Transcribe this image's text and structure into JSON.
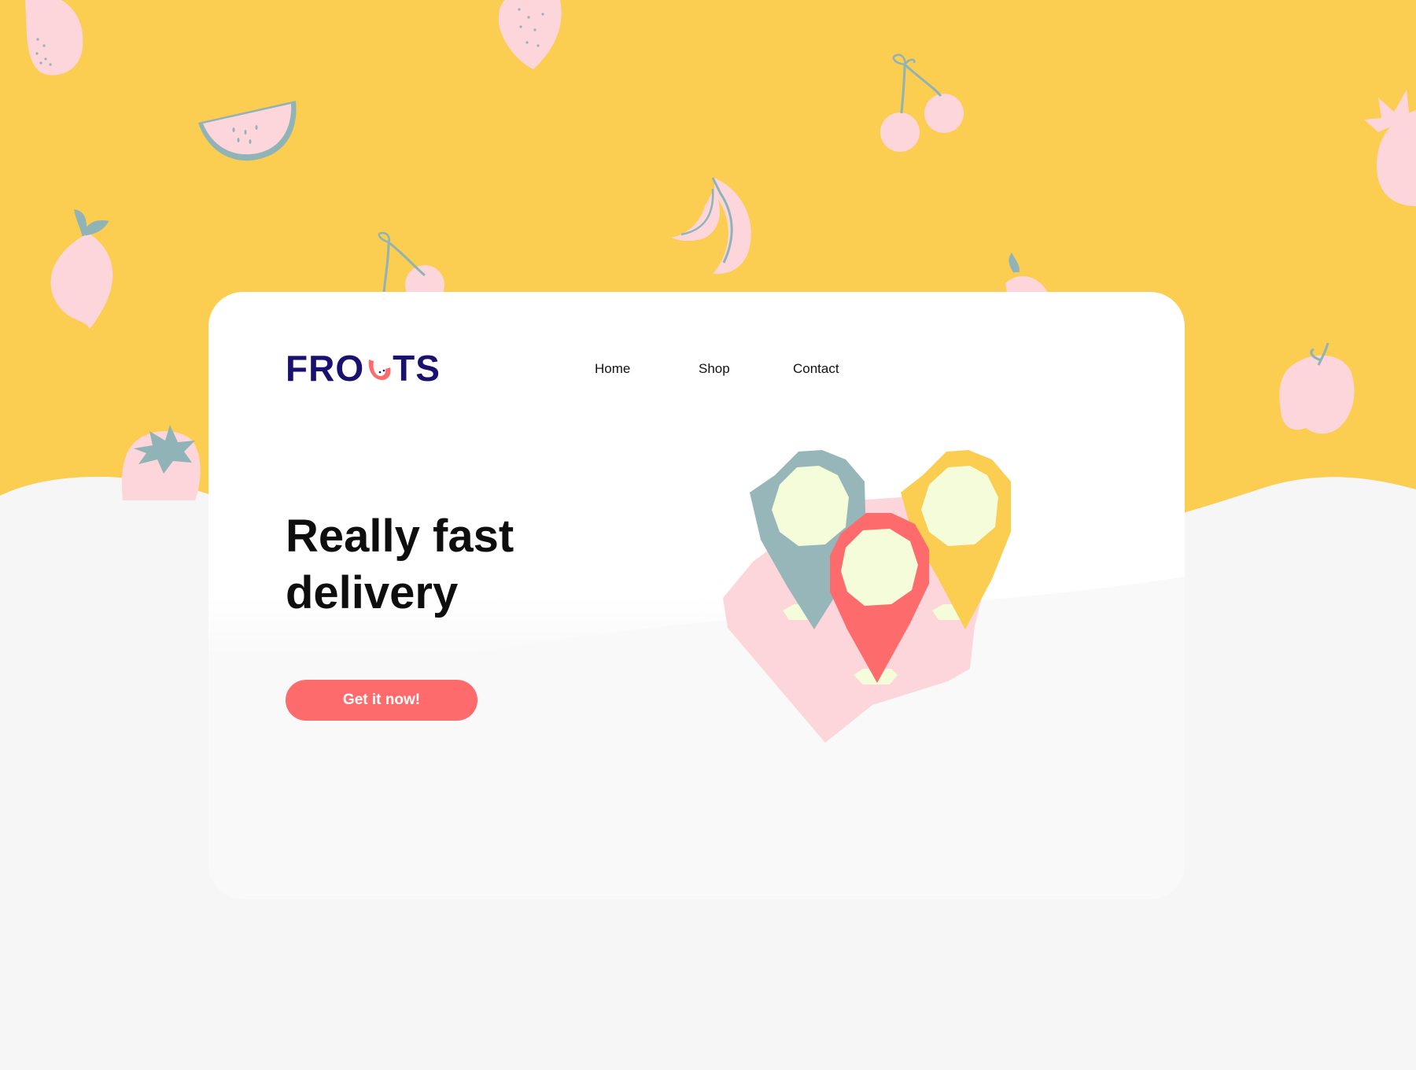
{
  "brand": {
    "logo_text_left": "FRO",
    "logo_text_right": "TS"
  },
  "nav": {
    "home": "Home",
    "shop": "Shop",
    "contact": "Contact"
  },
  "hero": {
    "headline_line1": "Really fast",
    "headline_line2": "delivery",
    "cta_label": "Get it now!"
  },
  "colors": {
    "background_yellow": "#fbcd50",
    "background_grey": "#f6f6f6",
    "fruit_pink": "#fcd6da",
    "fruit_stem_blue": "#8fb3b7",
    "logo_navy": "#1a1070",
    "accent_coral": "#fd6b6c",
    "pin_blue": "#96b6ba",
    "pin_yellow": "#fbcd50",
    "pin_cream": "#f4fcd9"
  },
  "icons": [
    "strawberry-icon",
    "watermelon-icon",
    "cherry-icon",
    "banana-icon",
    "lemon-icon",
    "apple-icon",
    "tomato-icon",
    "pomegranate-icon",
    "location-pin-icon"
  ]
}
